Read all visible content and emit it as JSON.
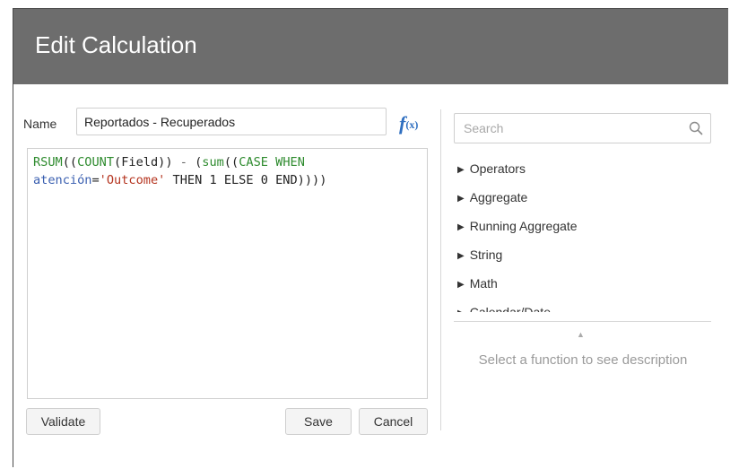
{
  "dialog": {
    "title": "Edit Calculation"
  },
  "name_field": {
    "label": "Name",
    "value": "Reportados - Recuperados"
  },
  "fx_icon": {
    "glyph": "f",
    "sub": "(x)",
    "icon": "function-icon"
  },
  "editor": {
    "lines": [
      [
        {
          "t": "fn",
          "v": "RSUM"
        },
        {
          "t": "plain",
          "v": "(("
        },
        {
          "t": "fn",
          "v": "COUNT"
        },
        {
          "t": "plain",
          "v": "(Field))"
        },
        {
          "t": "op",
          "v": " - "
        },
        {
          "t": "plain",
          "v": "("
        },
        {
          "t": "fn",
          "v": "sum"
        },
        {
          "t": "plain",
          "v": "(("
        },
        {
          "t": "kw",
          "v": "CASE WHEN"
        }
      ],
      [
        {
          "t": "field",
          "v": "atención"
        },
        {
          "t": "plain",
          "v": "="
        },
        {
          "t": "str",
          "v": "'Outcome'"
        },
        {
          "t": "plain",
          "v": " THEN 1 ELSE 0 END))))"
        }
      ]
    ]
  },
  "buttons": {
    "validate": "Validate",
    "save": "Save",
    "cancel": "Cancel"
  },
  "search": {
    "placeholder": "Search",
    "icon": "search-icon"
  },
  "functions": {
    "categories": [
      "Operators",
      "Aggregate",
      "Running Aggregate",
      "String",
      "Math",
      "Calendar/Date"
    ]
  },
  "description": {
    "text": "Select a function to see description"
  },
  "colors": {
    "header_bg": "#6d6d6d",
    "accent": "#2f6fc0",
    "keyword": "#2e8b2e",
    "string": "#b5341f",
    "field": "#3a5fb0"
  }
}
